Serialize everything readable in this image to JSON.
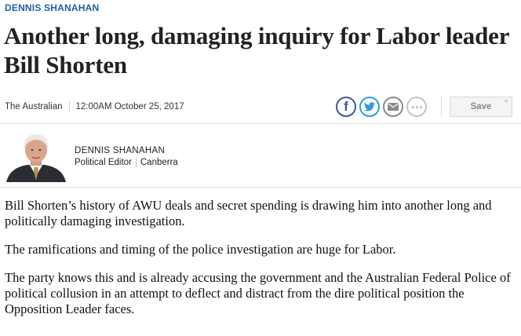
{
  "article": {
    "kicker": "DENNIS SHANAHAN",
    "headline": "Another long, damaging inquiry for Labor leader Bill Shorten",
    "publication": "The Australian",
    "datetime": "12:00AM October 25, 2017"
  },
  "share": {
    "icons": [
      "facebook-icon",
      "twitter-icon",
      "email-icon",
      "more-icon"
    ],
    "facebook_glyph": "f",
    "save_label": "Save",
    "save_plus": "+"
  },
  "author": {
    "name": "DENNIS SHANAHAN",
    "role": "Political Editor",
    "location": "Canberra"
  },
  "body": {
    "paragraphs": [
      "Bill Shorten’s history of AWU deals and secret spending is drawing him into another long and politically damaging investigation.",
      "The ramifications and timing of the police investigation are huge for Labor.",
      "The party knows this and is already accusing the government and the Australian Federal Police of political collusion in an attempt to deflect and distract from the dire political position the Opposition Leader faces."
    ]
  },
  "colors": {
    "kicker": "#1f5f9f",
    "facebook": "#3b5a9a",
    "twitter": "#2d9fd9",
    "email": "#8a8a8a"
  }
}
